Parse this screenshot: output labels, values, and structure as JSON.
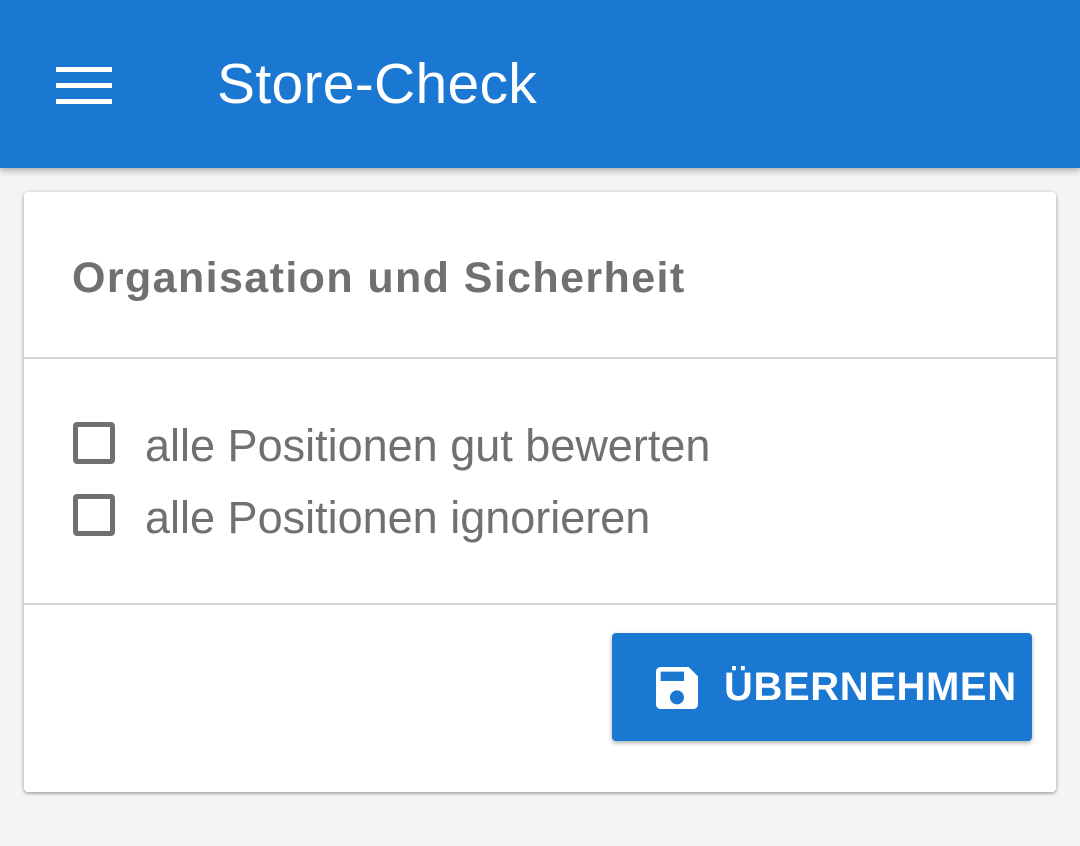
{
  "app_bar": {
    "title": "Store-Check",
    "menu_icon": "menu-icon",
    "background_color": "#1a77d2"
  },
  "card": {
    "title": "Organisation und Sicherheit",
    "options": [
      {
        "label": "alle Positionen gut bewerten",
        "checked": false
      },
      {
        "label": "alle Positionen ignorieren",
        "checked": false
      }
    ],
    "submit": {
      "label": "ÜBERNEHMEN",
      "icon": "save-icon"
    }
  },
  "colors": {
    "accent": "#1a77d2",
    "text_secondary": "#707070",
    "page_background": "#f4f4f4"
  }
}
